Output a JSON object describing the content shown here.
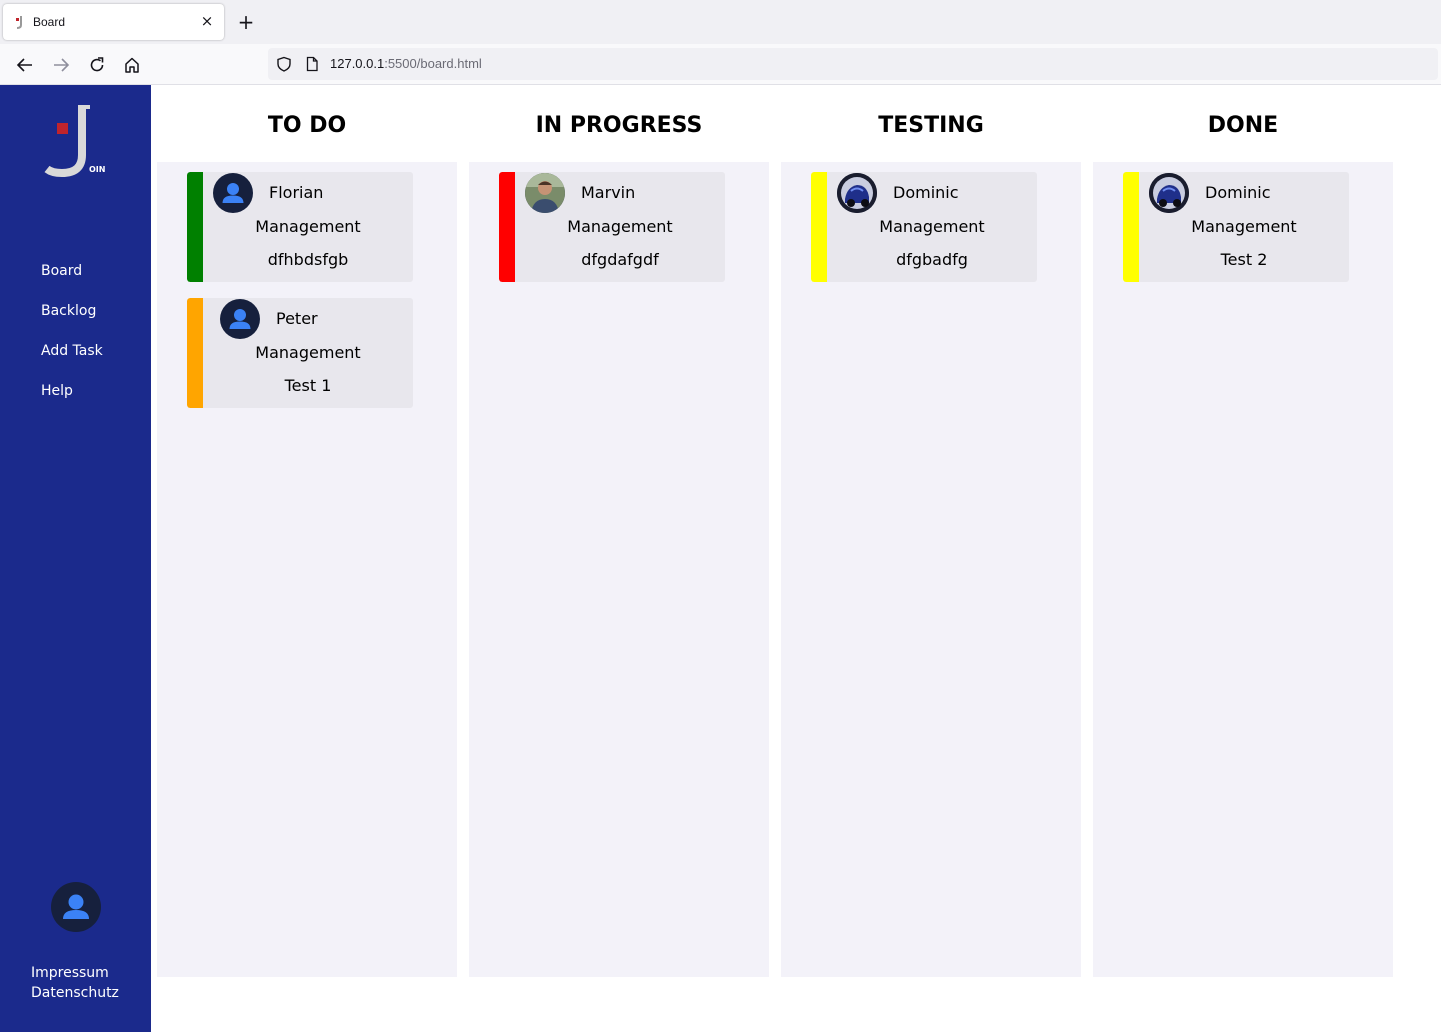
{
  "browser": {
    "tab_title": "Board",
    "tab_close": "×",
    "new_tab": "+",
    "url_host": "127.0.0.1",
    "url_rest": ":5500/board.html"
  },
  "sidebar": {
    "nav": [
      {
        "label": "Board"
      },
      {
        "label": "Backlog"
      },
      {
        "label": "Add Task"
      },
      {
        "label": "Help"
      }
    ],
    "footer": {
      "impressum": "Impressum",
      "datenschutz": "Datenschutz"
    },
    "logo_small_text": "OIN"
  },
  "colors": {
    "sidebar": "#1b2a8c",
    "column_bg": "#f3f2f9",
    "card_bg": "#e8e7ed",
    "urgency_green": "#008000",
    "urgency_orange": "#ffa500",
    "urgency_red": "#ff0000",
    "urgency_yellow": "#ffff00"
  },
  "board": {
    "columns": [
      {
        "title": "TO DO",
        "cards": [
          {
            "name": "Florian",
            "category": "Management",
            "title": "dfhbdsfgb",
            "urgency_color": "#008000",
            "avatar": "default-user-icon"
          },
          {
            "name": "Peter",
            "category": "Management",
            "title": "Test 1",
            "urgency_color": "#ffa500",
            "avatar": "default-user-icon"
          }
        ]
      },
      {
        "title": "IN PROGRESS",
        "cards": [
          {
            "name": "Marvin",
            "category": "Management",
            "title": "dfgdafgdf",
            "urgency_color": "#ff0000",
            "avatar": "photo-avatar"
          }
        ]
      },
      {
        "title": "TESTING",
        "cards": [
          {
            "name": "Dominic",
            "category": "Management",
            "title": "dfgbadfg",
            "urgency_color": "#ffff00",
            "avatar": "car-photo-avatar"
          }
        ]
      },
      {
        "title": "DONE",
        "cards": [
          {
            "name": "Dominic",
            "category": "Management",
            "title": "Test 2",
            "urgency_color": "#ffff00",
            "avatar": "car-photo-avatar"
          }
        ]
      }
    ]
  }
}
